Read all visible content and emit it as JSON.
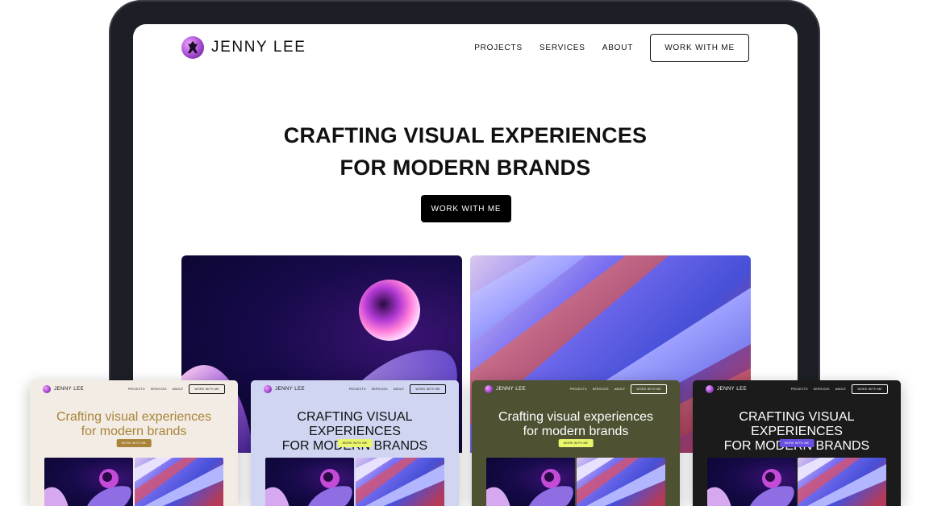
{
  "site": {
    "logo_text": "JENNY LEE",
    "nav": [
      "PROJECTS",
      "SERVICES",
      "ABOUT"
    ],
    "nav_cta": "WORK WITH ME",
    "hero": {
      "title_line1": "CRAFTING VISUAL EXPERIENCES",
      "title_line2": "FOR MODERN BRANDS",
      "cta": "WORK WITH ME"
    }
  },
  "variants": [
    {
      "name": "beige",
      "logo_text": "JENNY LEE",
      "nav": [
        "PROJECTS",
        "SERVICES",
        "ABOUT"
      ],
      "nav_cta": "WORK WITH ME",
      "title_line1": "Crafting visual experiences",
      "title_line2": "for modern brands",
      "cta": "WORK WITH ME",
      "bg": "#f2ece4",
      "text_color": "#111111",
      "title_color": "#a98338",
      "button_bg": "#a98338",
      "button_text": "#ffffff"
    },
    {
      "name": "lavender",
      "logo_text": "JENNY LEE",
      "nav": [
        "PROJECTS",
        "SERVICES",
        "ABOUT"
      ],
      "nav_cta": "WORK WITH ME",
      "title_line1": "CRAFTING VISUAL EXPERIENCES",
      "title_line2": "FOR MODERN BRANDS",
      "cta": "WORK WITH ME",
      "bg": "#d0d6f2",
      "text_color": "#111111",
      "title_color": "#111111",
      "button_bg": "#e9f56a",
      "button_text": "#111111"
    },
    {
      "name": "olive",
      "logo_text": "JENNY LEE",
      "nav": [
        "PROJECTS",
        "SERVICES",
        "ABOUT"
      ],
      "nav_cta": "WORK WITH ME",
      "title_line1": "Crafting visual experiences",
      "title_line2": "for modern brands",
      "cta": "WORK WITH ME",
      "bg": "#4e5232",
      "text_color": "#ffffff",
      "title_color": "#ffffff",
      "button_bg": "#e9f56a",
      "button_text": "#111111"
    },
    {
      "name": "dark",
      "logo_text": "JENNY LEE",
      "nav": [
        "PROJECTS",
        "SERVICES",
        "ABOUT"
      ],
      "nav_cta": "WORK WITH ME",
      "title_line1": "CRAFTING VISUAL EXPERIENCES",
      "title_line2": "FOR MODERN BRANDS",
      "cta": "WORK WITH ME",
      "bg": "#1b1b1b",
      "text_color": "#ffffff",
      "title_color": "#ffffff",
      "button_bg": "#6b4fe0",
      "button_text": "#ffffff"
    }
  ]
}
